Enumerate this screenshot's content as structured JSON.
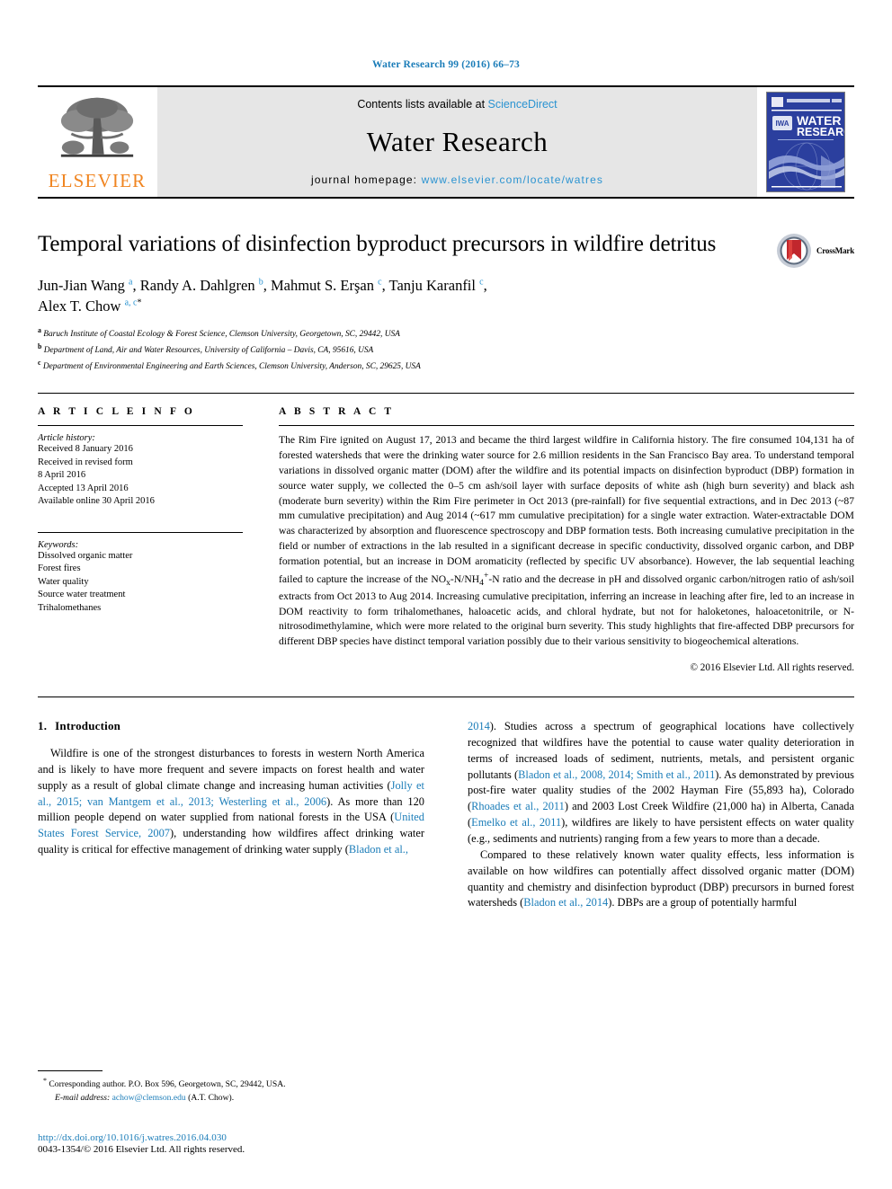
{
  "running_head": "Water Research 99 (2016) 66–73",
  "masthead": {
    "contents_prefix": "Contents lists available at",
    "sciencedirect": "ScienceDirect",
    "journal_name": "Water Research",
    "homepage_label": "journal homepage:",
    "homepage_url": "www.elsevier.com/locate/watres",
    "publisher": "ELSEVIER",
    "cover_title_line1": "WATER",
    "cover_title_line2": "RESEARCH",
    "cover_logo": "IWA",
    "link_color": "#2a93d1",
    "publisher_color": "#f08521"
  },
  "article": {
    "title": "Temporal variations of disinfection byproduct precursors in wildfire detritus",
    "crossmark_label": "CrossMark",
    "authors_line1": "Jun-Jian Wang ",
    "authors_line1_b": ", Randy A. Dahlgren ",
    "authors_line1_c": ", Mahmut S. Erşan ",
    "authors_line1_d": ", Tanju Karanfil ",
    "authors_line2": "Alex T. Chow ",
    "affiliations": [
      {
        "mark": "a",
        "text": "Baruch Institute of Coastal Ecology & Forest Science, Clemson University, Georgetown, SC, 29442, USA"
      },
      {
        "mark": "b",
        "text": "Department of Land, Air and Water Resources, University of California – Davis, CA, 95616, USA"
      },
      {
        "mark": "c",
        "text": "Department of Environmental Engineering and Earth Sciences, Clemson University, Anderson, SC, 29625, USA"
      }
    ]
  },
  "article_info": {
    "heading": "A R T I C L E   I N F O",
    "history_label": "Article history:",
    "history": [
      "Received 8 January 2016",
      "Received in revised form",
      "8 April 2016",
      "Accepted 13 April 2016",
      "Available online 30 April 2016"
    ],
    "keywords_label": "Keywords:",
    "keywords": [
      "Dissolved organic matter",
      "Forest fires",
      "Water quality",
      "Source water treatment",
      "Trihalomethanes"
    ]
  },
  "abstract": {
    "heading": "A B S T R A C T",
    "text_part1": "The Rim Fire ignited on August 17, 2013 and became the third largest wildfire in California history. The fire consumed 104,131 ha of forested watersheds that were the drinking water source for 2.6 million residents in the San Francisco Bay area. To understand temporal variations in dissolved organic matter (DOM) after the wildfire and its potential impacts on disinfection byproduct (DBP) formation in source water supply, we collected the 0–5 cm ash/soil layer with surface deposits of white ash (high burn severity) and black ash (moderate burn severity) within the Rim Fire perimeter in Oct 2013 (pre-rainfall) for five sequential extractions, and in Dec 2013 (~87 mm cumulative precipitation) and Aug 2014 (~617 mm cumulative precipitation) for a single water extraction. Water-extractable DOM was characterized by absorption and fluorescence spectroscopy and DBP formation tests. Both increasing cumulative precipitation in the field or number of extractions in the lab resulted in a significant decrease in specific conductivity, dissolved organic carbon, and DBP formation potential, but an increase in DOM aromaticity (reflected by specific UV absorbance). However, the lab sequential leaching failed to capture the increase of the NO",
    "sub1": "x",
    "text_part2": "-N/NH",
    "sub2": "4",
    "text_part3": "-N ratio and the decrease in pH and dissolved organic carbon/nitrogen ratio of ash/soil extracts from Oct 2013 to Aug 2014. Increasing cumulative precipitation, inferring an increase in leaching after fire, led to an increase in DOM reactivity to form trihalomethanes, haloacetic acids, and chloral hydrate, but not for haloketones, haloacetonitrile, or N-nitrosodimethylamine, which were more related to the original burn severity. This study highlights that fire-affected DBP precursors for different DBP species have distinct temporal variation possibly due to their various sensitivity to biogeochemical alterations.",
    "copyright": "© 2016 Elsevier Ltd. All rights reserved."
  },
  "introduction": {
    "number": "1.",
    "title": "Introduction",
    "left_p1_a": "Wildfire is one of the strongest disturbances to forests in western North America and is likely to have more frequent and severe impacts on forest health and water supply as a result of global climate change and increasing human activities (",
    "left_cite1": "Jolly et al., 2015; van Mantgem et al., 2013; Westerling et al., 2006",
    "left_p1_b": "). As more than 120 million people depend on water supplied from national forests in the USA (",
    "left_cite2": "United States Forest Service, 2007",
    "left_p1_c": "), understanding how wildfires affect drinking water quality is critical for effective management of drinking water supply (",
    "left_cite3": "Bladon et al.,",
    "right_p1_a": "2014",
    "right_p1_b": "). Studies across a spectrum of geographical locations have collectively recognized that wildfires have the potential to cause water quality deterioration in terms of increased loads of sediment, nutrients, metals, and persistent organic pollutants (",
    "right_cite1": "Bladon et al., 2008, 2014; Smith et al., 2011",
    "right_p1_c": "). As demonstrated by previous post-fire water quality studies of the 2002 Hayman Fire (55,893 ha), Colorado (",
    "right_cite2": "Rhoades et al., 2011",
    "right_p1_d": ") and 2003 Lost Creek Wildfire (21,000 ha) in Alberta, Canada (",
    "right_cite3": "Emelko et al., 2011",
    "right_p1_e": "), wildfires are likely to have persistent effects on water quality (e.g., sediments and nutrients) ranging from a few years to more than a decade.",
    "right_p2_a": "Compared to these relatively known water quality effects, less information is available on how wildfires can potentially affect dissolved organic matter (DOM) quantity and chemistry and disinfection byproduct (DBP) precursors in burned forest watersheds (",
    "right_cite4": "Bladon et al., 2014",
    "right_p2_b": "). DBPs are a group of potentially harmful"
  },
  "footnote": {
    "marker": "*",
    "line1": "Corresponding author. P.O. Box 596, Georgetown, SC, 29442, USA.",
    "email_label": "E-mail address:",
    "email": "achow@clemson.edu",
    "email_suffix": "(A.T. Chow)."
  },
  "footer": {
    "doi": "http://dx.doi.org/10.1016/j.watres.2016.04.030",
    "issn_line": "0043-1354/© 2016 Elsevier Ltd. All rights reserved."
  }
}
